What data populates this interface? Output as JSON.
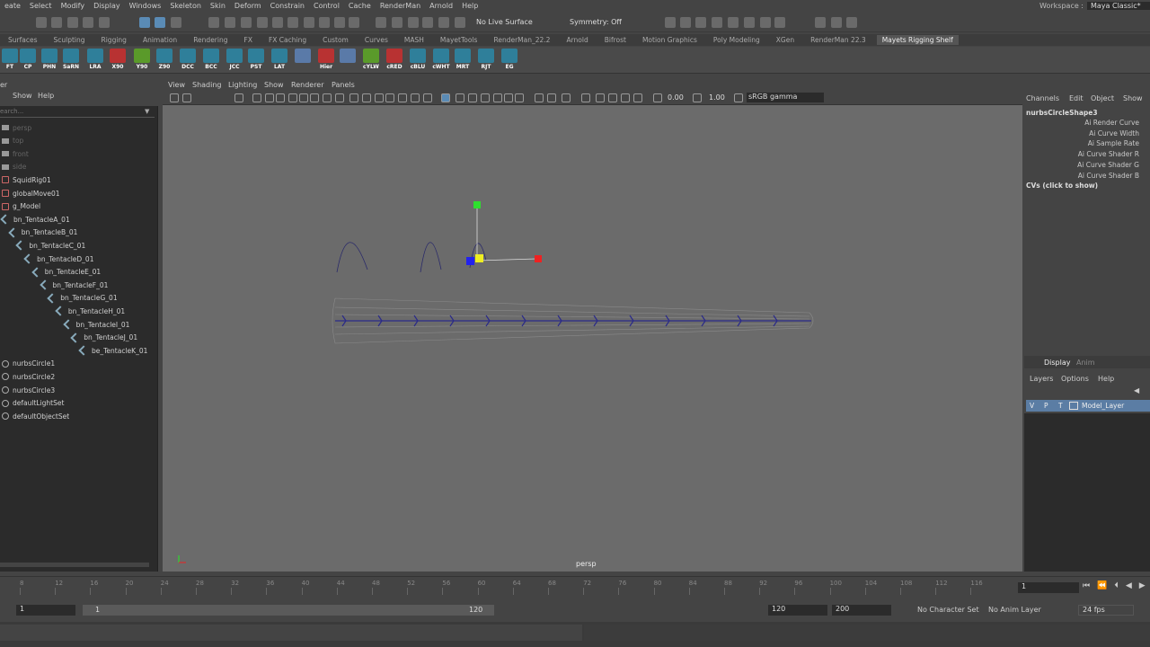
{
  "menubar": {
    "items": [
      "eate",
      "Select",
      "Modify",
      "Display",
      "Windows",
      "Skeleton",
      "Skin",
      "Deform",
      "Constrain",
      "Control",
      "Cache",
      "RenderMan",
      "Arnold",
      "Help"
    ],
    "workspace_label": "Workspace :",
    "workspace_value": "Maya Classic*"
  },
  "statusline": {
    "live_surface": "No Live Surface",
    "symmetry": "Symmetry: Off"
  },
  "shelf_tabs": [
    "Surfaces",
    "Sculpting",
    "Rigging",
    "Animation",
    "Rendering",
    "FX",
    "FX Caching",
    "Custom",
    "Curves",
    "MASH",
    "MayetTools",
    "RenderMan_22.2",
    "Arnold",
    "Bifrost",
    "Motion Graphics",
    "Poly Modeling",
    "XGen",
    "RenderMan 22.3",
    "Mayets Rigging Shelf"
  ],
  "shelf_buttons": [
    "FT",
    "CP",
    "PHN",
    "SaRN",
    "LRA",
    "X90",
    "Y90",
    "Z90",
    "DCC",
    "BCC",
    "JCC",
    "PST",
    "LAT",
    "",
    "Hier",
    "",
    "cYLW",
    "cRED",
    "cBLU",
    "cWHT",
    "MRT",
    "RJT",
    "EG"
  ],
  "outliner": {
    "title": "er",
    "menu": [
      "Show",
      "Help"
    ],
    "search_placeholder": "earch...",
    "items": [
      {
        "label": "persp",
        "dim": true,
        "icon": "camera"
      },
      {
        "label": "top",
        "dim": true,
        "icon": "camera"
      },
      {
        "label": "front",
        "dim": true,
        "icon": "camera"
      },
      {
        "label": "side",
        "dim": true,
        "icon": "camera"
      },
      {
        "label": "SquidRig01",
        "icon": "transform"
      },
      {
        "label": "globalMove01",
        "icon": "transform"
      },
      {
        "label": "g_Model",
        "icon": "transform"
      },
      {
        "label": "bn_TentacleA_01",
        "icon": "joint"
      },
      {
        "label": "bn_TentacleB_01",
        "icon": "joint"
      },
      {
        "label": "bn_TentacleC_01",
        "icon": "joint"
      },
      {
        "label": "bn_TentacleD_01",
        "icon": "joint"
      },
      {
        "label": "bn_TentacleE_01",
        "icon": "joint"
      },
      {
        "label": "bn_TentacleF_01",
        "icon": "joint"
      },
      {
        "label": "bn_TentacleG_01",
        "icon": "joint"
      },
      {
        "label": "bn_TentacleH_01",
        "icon": "joint"
      },
      {
        "label": "bn_TentacleI_01",
        "icon": "joint"
      },
      {
        "label": "bn_TentacleJ_01",
        "icon": "joint"
      },
      {
        "label": "be_TentacleK_01",
        "icon": "joint"
      },
      {
        "label": "nurbsCircle1",
        "icon": "curve"
      },
      {
        "label": "nurbsCircle2",
        "icon": "curve"
      },
      {
        "label": "nurbsCircle3",
        "icon": "curve"
      },
      {
        "label": "defaultLightSet",
        "icon": "set"
      },
      {
        "label": "defaultObjectSet",
        "icon": "set"
      }
    ]
  },
  "viewport": {
    "menu": [
      "View",
      "Shading",
      "Lighting",
      "Show",
      "Renderer",
      "Panels"
    ],
    "exposure": "0.00",
    "gamma": "1.00",
    "colorspace": "sRGB gamma",
    "camera_label": "persp"
  },
  "channelbox": {
    "menu": [
      "Channels",
      "Edit",
      "Object",
      "Show"
    ],
    "node": "nurbsCircleShape3",
    "attributes": [
      "Ai Render Curve",
      "Ai Curve Width",
      "Ai Sample Rate",
      "Ai Curve Shader R",
      "Ai Curve Shader G",
      "Ai Curve Shader B"
    ],
    "cvs": "CVs (click to show)"
  },
  "layers": {
    "tabs": [
      "Display",
      "Anim"
    ],
    "menu": [
      "Layers",
      "Options",
      "Help"
    ],
    "row_flags": [
      "V",
      "P",
      "T"
    ],
    "layer_name": "Model_Layer"
  },
  "timeslider": {
    "ticks": [
      "8",
      "12",
      "16",
      "20",
      "24",
      "28",
      "32",
      "36",
      "40",
      "44",
      "48",
      "52",
      "56",
      "60",
      "64",
      "68",
      "72",
      "76",
      "80",
      "84",
      "88",
      "92",
      "96",
      "100",
      "104",
      "108",
      "112",
      "116"
    ],
    "current_frame": "1"
  },
  "range": {
    "start": "1",
    "inner_start": "1",
    "inner_end": "120",
    "end": "120",
    "max": "200",
    "character_set": "No Character Set",
    "anim_layer": "No Anim Layer",
    "fps": "24 fps"
  }
}
